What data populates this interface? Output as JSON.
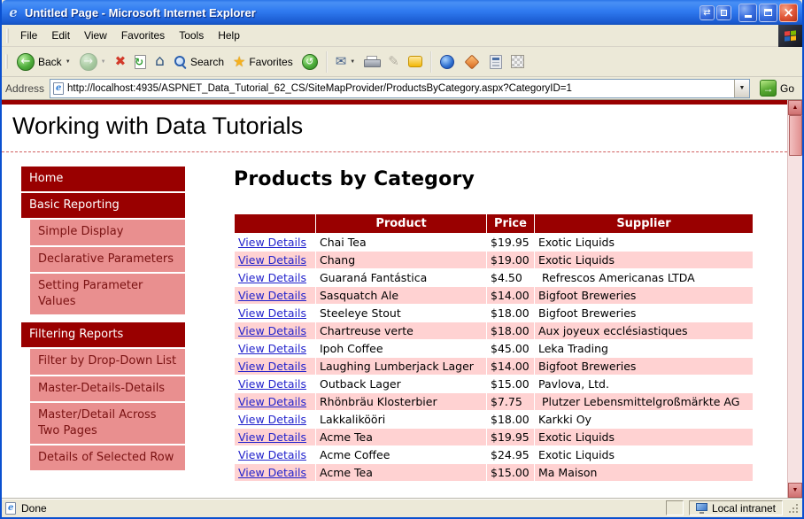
{
  "colors": {
    "maroon": "#990000",
    "sidebar-pink": "#e98f8f",
    "stripe-pink": "#ffd2d2",
    "link-blue": "#2222cc"
  },
  "window": {
    "title": "Untitled Page - Microsoft Internet Explorer"
  },
  "menu": {
    "items": [
      "File",
      "Edit",
      "View",
      "Favorites",
      "Tools",
      "Help"
    ]
  },
  "toolbar": {
    "back_label": "Back",
    "search_label": "Search",
    "favorites_label": "Favorites"
  },
  "address": {
    "label": "Address",
    "url": "http://localhost:4935/ASPNET_Data_Tutorial_62_CS/SiteMapProvider/ProductsByCategory.aspx?CategoryID=1",
    "go_label": "Go"
  },
  "status": {
    "done": "Done",
    "zone": "Local intranet"
  },
  "page": {
    "site_title": "Working with Data Tutorials",
    "heading": "Products by Category",
    "sidebar": [
      {
        "label": "Home",
        "indent": false,
        "gap_before": false
      },
      {
        "label": "Basic Reporting",
        "indent": false,
        "gap_before": false
      },
      {
        "label": "Simple Display",
        "indent": true,
        "gap_before": false
      },
      {
        "label": "Declarative Parameters",
        "indent": true,
        "gap_before": false
      },
      {
        "label": "Setting Parameter Values",
        "indent": true,
        "gap_before": false
      },
      {
        "label": "Filtering Reports",
        "indent": false,
        "gap_before": true
      },
      {
        "label": "Filter by Drop-Down List",
        "indent": true,
        "gap_before": false
      },
      {
        "label": "Master-Details-Details",
        "indent": true,
        "gap_before": false
      },
      {
        "label": "Master/Detail Across Two Pages",
        "indent": true,
        "gap_before": false
      },
      {
        "label": "Details of Selected Row",
        "indent": true,
        "gap_before": false
      }
    ],
    "table": {
      "link_label": "View Details",
      "headers": [
        "",
        "Product",
        "Price",
        "Supplier"
      ],
      "rows": [
        {
          "product": "Chai Tea",
          "price": "$19.95",
          "supplier": "Exotic Liquids"
        },
        {
          "product": "Chang",
          "price": "$19.00",
          "supplier": "Exotic Liquids"
        },
        {
          "product": "Guaraná Fantástica",
          "price": "$4.50",
          "supplier": " Refrescos Americanas LTDA"
        },
        {
          "product": "Sasquatch Ale",
          "price": "$14.00",
          "supplier": "Bigfoot Breweries"
        },
        {
          "product": "Steeleye Stout",
          "price": "$18.00",
          "supplier": "Bigfoot Breweries"
        },
        {
          "product": "Chartreuse verte",
          "price": "$18.00",
          "supplier": "Aux joyeux ecclésiastiques"
        },
        {
          "product": "Ipoh Coffee",
          "price": "$45.00",
          "supplier": "Leka Trading"
        },
        {
          "product": "Laughing Lumberjack Lager",
          "price": "$14.00",
          "supplier": "Bigfoot Breweries"
        },
        {
          "product": "Outback Lager",
          "price": "$15.00",
          "supplier": "Pavlova, Ltd."
        },
        {
          "product": "Rhönbräu Klosterbier",
          "price": "$7.75",
          "supplier": " Plutzer Lebensmittelgroßmärkte AG"
        },
        {
          "product": "Lakkalikööri",
          "price": "$18.00",
          "supplier": "Karkki Oy"
        },
        {
          "product": "Acme Tea",
          "price": "$19.95",
          "supplier": "Exotic Liquids"
        },
        {
          "product": "Acme Coffee",
          "price": "$24.95",
          "supplier": "Exotic Liquids"
        },
        {
          "product": "Acme Tea",
          "price": "$15.00",
          "supplier": "Ma Maison"
        }
      ]
    }
  },
  "icons": {
    "window_nav": "⇄",
    "close": "×",
    "back_arrow": "←",
    "forward_arrow": "→",
    "stop": "✖",
    "refresh": "↻",
    "home": "⌂",
    "favorites_star": "★",
    "history": "↺",
    "mail": "✉",
    "edit": "✎",
    "dropdown": "▼",
    "go_arrow": "→",
    "scroll_up": "▲",
    "scroll_down": "▼"
  }
}
